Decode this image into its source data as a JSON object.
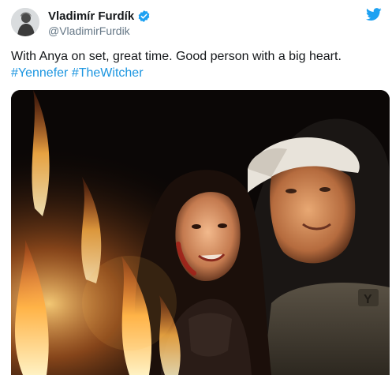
{
  "author": {
    "display_name": "Vladimír Furdík",
    "handle": "@VladimirFurdik",
    "verified": true,
    "avatar_icon": "profile-photo"
  },
  "tweet": {
    "text": "With Anya on set, great time. Good person with a big heart.",
    "hashtags": [
      "#Yennefer",
      "#TheWitcher"
    ]
  },
  "media": {
    "type": "photo"
  },
  "colors": {
    "brand": "#1da1f2",
    "link": "#1b95e0",
    "text": "#14171a",
    "secondary": "#657786"
  },
  "icons": {
    "verified": "verified-badge-icon",
    "brand": "twitter-bird-icon"
  }
}
